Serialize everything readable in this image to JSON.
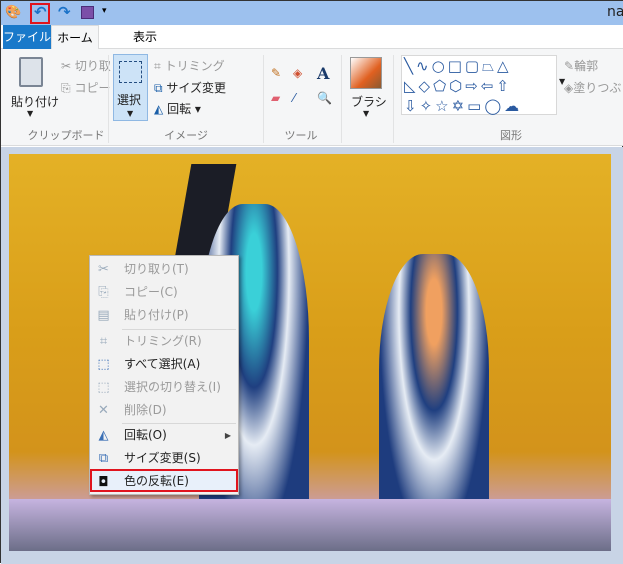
{
  "titlebar": {
    "title": "na",
    "quick_access": [
      "paint-icon",
      "undo-icon",
      "redo-icon",
      "save-icon",
      "customize-dropdown-icon"
    ]
  },
  "tabs": [
    {
      "label": "ファイル"
    },
    {
      "label": "ホーム"
    },
    {
      "label": "表示"
    }
  ],
  "ribbon": {
    "clipboard": {
      "label": "クリップボード",
      "paste": "貼り付け",
      "cut": "切り取り",
      "copy": "コピー"
    },
    "image": {
      "label": "イメージ",
      "select": "選択",
      "crop": "トリミング",
      "resize": "サイズ変更",
      "rotate": "回転"
    },
    "tools": {
      "label": "ツール"
    },
    "brush": {
      "label": "ブラシ"
    },
    "shapes": {
      "label": "図形",
      "outline": "輪郭",
      "fill": "塗りつぶ"
    }
  },
  "context_menu": {
    "items": [
      {
        "label": "切り取り(T)",
        "icon": "scissors-icon",
        "enabled": false
      },
      {
        "label": "コピー(C)",
        "icon": "copy-icon",
        "enabled": false
      },
      {
        "label": "貼り付け(P)",
        "icon": "paste-icon",
        "enabled": false
      },
      {
        "label": "トリミング(R)",
        "icon": "crop-icon",
        "enabled": false
      },
      {
        "label": "すべて選択(A)",
        "icon": "select-all-icon",
        "enabled": true
      },
      {
        "label": "選択の切り替え(I)",
        "icon": "invert-selection-icon",
        "enabled": false
      },
      {
        "label": "削除(D)",
        "icon": "delete-icon",
        "enabled": false
      },
      {
        "label": "回転(O)",
        "icon": "rotate-icon",
        "enabled": true,
        "submenu": true
      },
      {
        "label": "サイズ変更(S)",
        "icon": "resize-icon",
        "enabled": true
      },
      {
        "label": "色の反転(E)",
        "icon": "invert-color-icon",
        "enabled": true,
        "highlighted": true
      }
    ]
  },
  "colors": {
    "highlight_box": "#e0141e",
    "file_tab": "#1979ca",
    "titlebar": "#9dc1ee"
  }
}
